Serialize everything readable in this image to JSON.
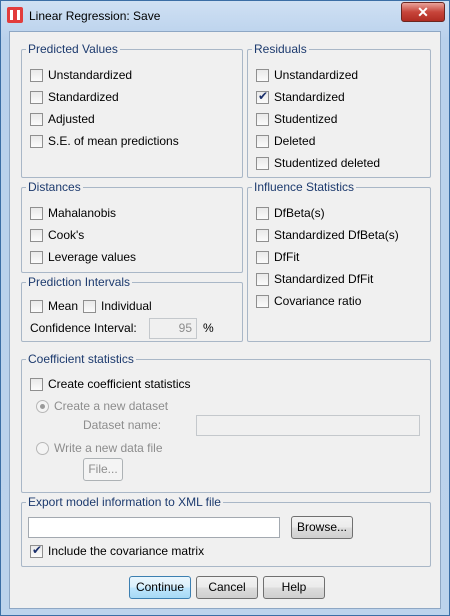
{
  "window": {
    "title": "Linear Regression: Save",
    "close_label": "✕"
  },
  "predicted_values": {
    "legend": "Predicted Values",
    "items": [
      {
        "label": "Unstandardized",
        "checked": false
      },
      {
        "label": "Standardized",
        "checked": false
      },
      {
        "label": "Adjusted",
        "checked": false
      },
      {
        "label": "S.E. of mean predictions",
        "checked": false
      }
    ]
  },
  "residuals": {
    "legend": "Residuals",
    "items": [
      {
        "label": "Unstandardized",
        "checked": false
      },
      {
        "label": "Standardized",
        "checked": true
      },
      {
        "label": "Studentized",
        "checked": false
      },
      {
        "label": "Deleted",
        "checked": false
      },
      {
        "label": "Studentized deleted",
        "checked": false
      }
    ]
  },
  "distances": {
    "legend": "Distances",
    "items": [
      {
        "label": "Mahalanobis",
        "checked": false
      },
      {
        "label": "Cook's",
        "checked": false
      },
      {
        "label": "Leverage values",
        "checked": false
      }
    ]
  },
  "influence": {
    "legend": "Influence Statistics",
    "items": [
      {
        "label": "DfBeta(s)",
        "checked": false
      },
      {
        "label": "Standardized DfBeta(s)",
        "checked": false
      },
      {
        "label": "DfFit",
        "checked": false
      },
      {
        "label": "Standardized DfFit",
        "checked": false
      },
      {
        "label": "Covariance ratio",
        "checked": false
      }
    ]
  },
  "prediction_intervals": {
    "legend": "Prediction Intervals",
    "mean_label": "Mean",
    "individual_label": "Individual",
    "confidence_label": "Confidence Interval:",
    "confidence_value": "95",
    "percent": "%"
  },
  "coefficient": {
    "legend": "Coefficient statistics",
    "create_label": "Create coefficient statistics",
    "new_dataset_label": "Create a new dataset",
    "dataset_name_label": "Dataset name:",
    "dataset_name_value": "",
    "new_file_label": "Write a new data file",
    "file_button": "File..."
  },
  "export": {
    "legend": "Export model information to XML file",
    "path_value": "",
    "browse_button": "Browse...",
    "covariance_label": "Include the covariance matrix",
    "covariance_checked": true
  },
  "buttons": {
    "continue": "Continue",
    "cancel": "Cancel",
    "help": "Help"
  }
}
